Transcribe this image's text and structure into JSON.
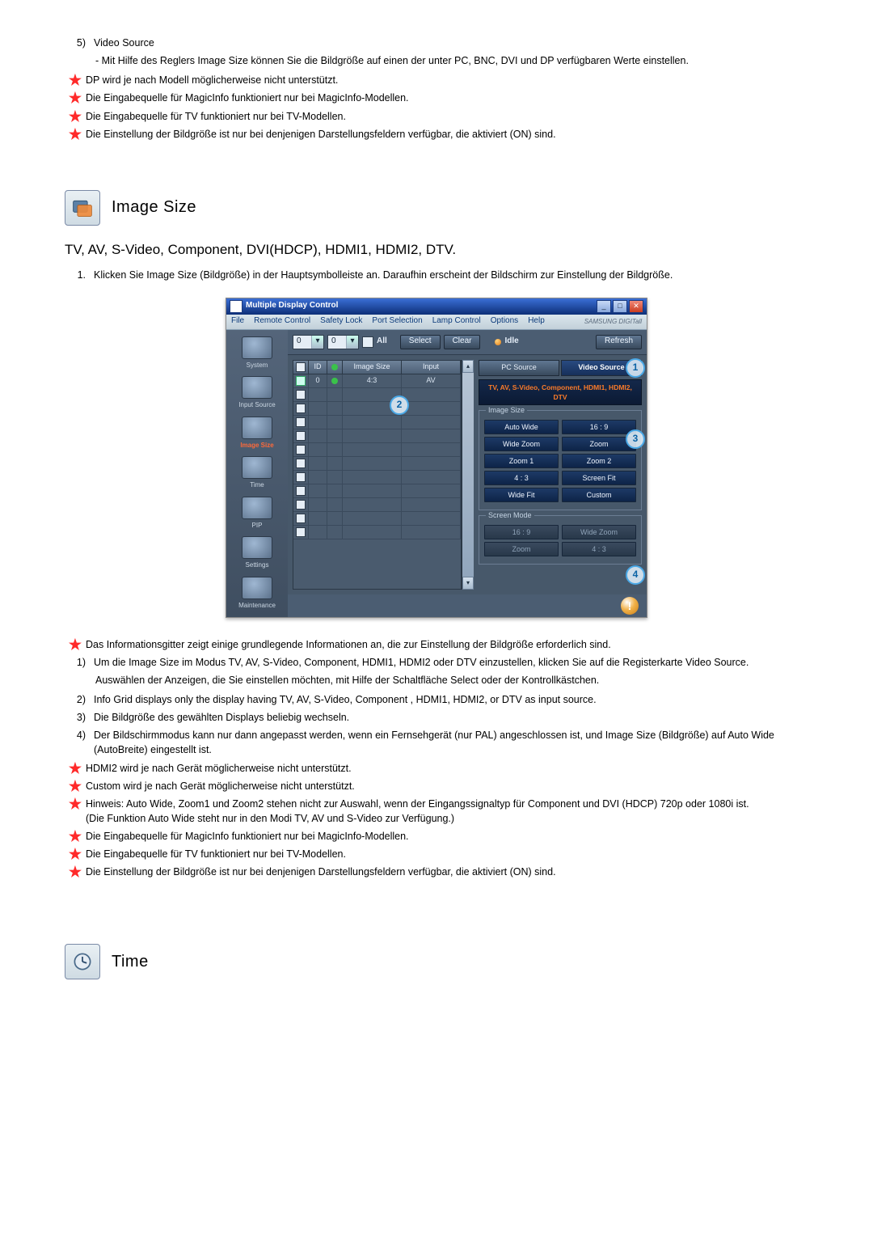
{
  "section5": {
    "num": "5)",
    "title": "Video Source",
    "desc": "- Mit Hilfe des Reglers Image Size können Sie die Bildgröße auf einen der unter PC, BNC, DVI und DP verfügbaren Werte einstellen."
  },
  "notes_top": [
    "DP wird je nach Modell möglicherweise nicht unterstützt.",
    "Die Eingabequelle für MagicInfo funktioniert nur bei MagicInfo-Modellen.",
    "Die Eingabequelle für TV funktioniert nur bei TV-Modellen.",
    "Die Einstellung der Bildgröße ist nur bei denjenigen Darstellungsfeldern verfügbar, die aktiviert (ON) sind."
  ],
  "heading": {
    "title": "Image Size"
  },
  "subhead": "TV, AV, S-Video, Component, DVI(HDCP), HDMI1, HDMI2, DTV.",
  "step1": {
    "num": "1.",
    "text": "Klicken Sie Image Size (Bildgröße) in der Hauptsymbolleiste an. Daraufhin erscheint der Bildschirm zur Einstellung der Bildgröße."
  },
  "app": {
    "title": "Multiple Display Control",
    "menus": [
      "File",
      "Remote Control",
      "Safety Lock",
      "Port Selection",
      "Lamp Control",
      "Options",
      "Help"
    ],
    "brand": "SAMSUNG DIGITall",
    "side": [
      "System",
      "Input Source",
      "Image Size",
      "Time",
      "PIP",
      "Settings",
      "Maintenance"
    ],
    "toolbar": {
      "d1": "0",
      "d2": "0",
      "all": "All",
      "select": "Select",
      "clear": "Clear",
      "idle": "Idle",
      "refresh": "Refresh"
    },
    "grid": {
      "head": [
        "",
        "ID",
        "",
        "Image Size",
        "Input"
      ],
      "rows": [
        [
          "☑",
          "0",
          "●",
          "4:3",
          "AV"
        ]
      ]
    },
    "tabs": {
      "pc": "PC Source",
      "video": "Video Source"
    },
    "panel_header": "TV, AV, S-Video, Component, HDMI1, HDMI2, DTV",
    "fs1": {
      "legend": "Image Size",
      "rows": [
        [
          "Auto Wide",
          "16 : 9"
        ],
        [
          "Wide Zoom",
          "Zoom"
        ],
        [
          "Zoom 1",
          "Zoom 2"
        ],
        [
          "4 : 3",
          "Screen Fit"
        ],
        [
          "Wide Fit",
          "Custom"
        ]
      ]
    },
    "fs2": {
      "legend": "Screen Mode",
      "rows": [
        [
          "16 : 9",
          "Wide Zoom"
        ],
        [
          "Zoom",
          "4 : 3"
        ]
      ]
    },
    "markers": {
      "m1": "1",
      "m2": "2",
      "m3": "3",
      "m4": "4"
    }
  },
  "after_note": "Das Informationsgitter zeigt einige grundlegende Informationen an, die zur Einstellung der Bildgröße erforderlich sind.",
  "numbered": [
    {
      "n": "1)",
      "t": "Um die Image Size im Modus TV, AV, S-Video, Component, HDMI1, HDMI2 oder DTV einzustellen, klicken Sie auf die Registerkarte Video Source.",
      "sub": "Auswählen der Anzeigen, die Sie einstellen möchten, mit Hilfe der Schaltfläche Select oder der Kontrollkästchen."
    },
    {
      "n": "2)",
      "t": "Info Grid displays only the display having TV, AV, S-Video, Component , HDMI1, HDMI2, or DTV as input source."
    },
    {
      "n": "3)",
      "t": "Die Bildgröße des gewählten Displays beliebig wechseln."
    },
    {
      "n": "4)",
      "t": "Der Bildschirmmodus kann nur dann angepasst werden, wenn ein Fernsehgerät (nur PAL) angeschlossen ist, und Image Size (Bildgröße) auf Auto Wide (AutoBreite) eingestellt ist."
    }
  ],
  "notes_bottom": [
    "HDMI2 wird je nach Gerät möglicherweise nicht unterstützt.",
    "Custom wird je nach Gerät möglicherweise nicht unterstützt.",
    "Hinweis: Auto Wide, Zoom1 und Zoom2 stehen nicht zur Auswahl, wenn der Eingangssignaltyp für Component und DVI (HDCP) 720p oder 1080i ist.\n(Die Funktion Auto Wide steht nur in den Modi TV, AV und S-Video zur Verfügung.)",
    "Die Eingabequelle für MagicInfo funktioniert nur bei MagicInfo-Modellen.",
    "Die Eingabequelle für TV funktioniert nur bei TV-Modellen.",
    "Die Einstellung der Bildgröße ist nur bei denjenigen Darstellungsfeldern verfügbar, die aktiviert (ON) sind."
  ],
  "heading2": {
    "title": "Time"
  }
}
